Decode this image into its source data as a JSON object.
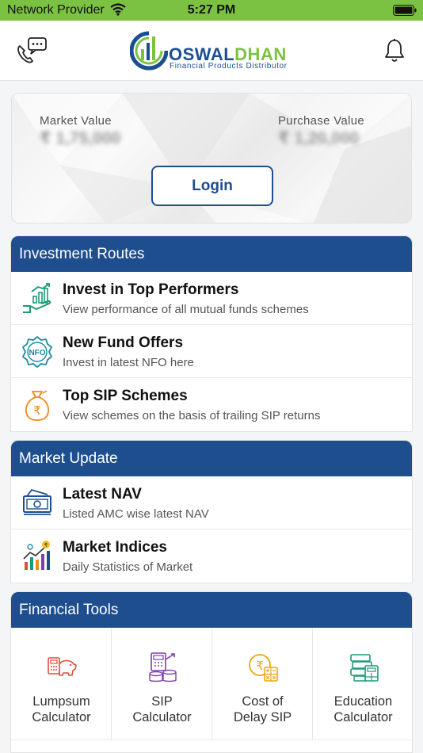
{
  "status_bar": {
    "carrier": "Network Provider",
    "time": "5:27 PM",
    "wifi_icon": "wifi-icon",
    "battery_icon": "battery-icon"
  },
  "header": {
    "brand_oswal": "OSWAL",
    "brand_dhan": "DHAN",
    "tagline": "Financial Products Distributor",
    "call_icon": "chat-phone-icon",
    "bell_icon": "bell-icon"
  },
  "portfolio": {
    "market_value_label": "Market Value",
    "market_value": "₹ 1,75,000",
    "purchase_value_label": "Purchase Value",
    "purchase_value": "₹ 1,20,000",
    "login_label": "Login"
  },
  "investment_routes": {
    "title": "Investment Routes",
    "items": [
      {
        "title": "Invest in Top Performers",
        "subtitle": "View performance of all mutual funds schemes",
        "icon": "growth-hand-icon"
      },
      {
        "title": "New Fund Offers",
        "subtitle": "Invest in latest NFO here",
        "icon": "nfo-badge-icon"
      },
      {
        "title": "Top SIP Schemes",
        "subtitle": "View schemes on the basis of trailing SIP returns",
        "icon": "money-bag-icon"
      }
    ]
  },
  "market_update": {
    "title": "Market Update",
    "items": [
      {
        "title": "Latest NAV",
        "subtitle": "Listed AMC wise latest NAV",
        "icon": "banknote-icon"
      },
      {
        "title": "Market Indices",
        "subtitle": "Daily Statistics of Market",
        "icon": "bar-chart-icon"
      }
    ]
  },
  "financial_tools": {
    "title": "Financial Tools",
    "items": [
      {
        "line1": "Lumpsum",
        "line2": "Calculator",
        "icon": "piggy-calculator-icon"
      },
      {
        "line1": "SIP",
        "line2": "Calculator",
        "icon": "coins-calculator-icon"
      },
      {
        "line1": "Cost of",
        "line2": "Delay SIP",
        "icon": "rupee-calculator-icon"
      },
      {
        "line1": "Education",
        "line2": "Calculator",
        "icon": "books-calculator-icon"
      }
    ]
  },
  "colors": {
    "status_green": "#7cc242",
    "brand_blue": "#1f4e8f",
    "accent_green": "#7cc242"
  }
}
